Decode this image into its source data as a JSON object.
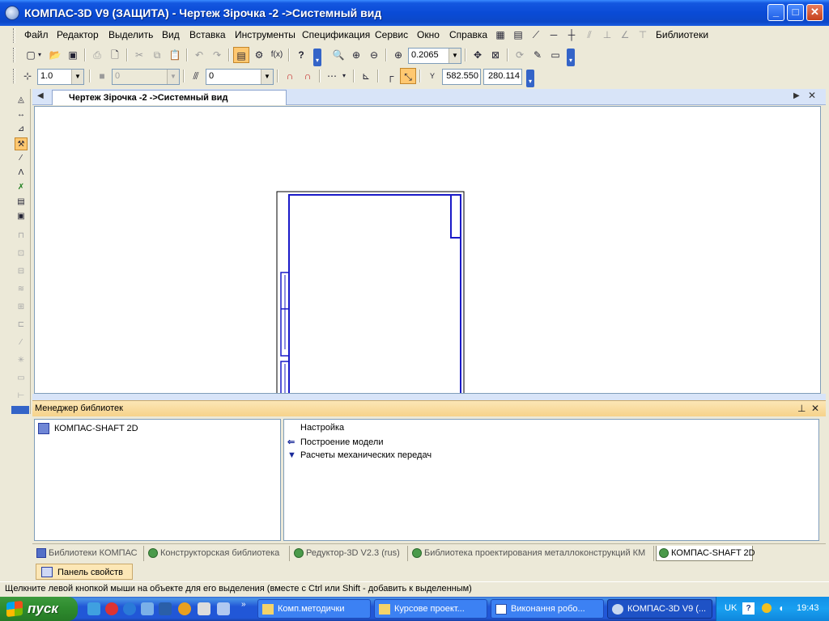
{
  "window": {
    "title": "КОМПАС-3D V9 (ЗАЩИТА) - Чертеж Зірочка -2 ->Системный вид",
    "minimize_glyph": "_",
    "maximize_glyph": "□",
    "close_glyph": "✕"
  },
  "menu": {
    "items": [
      "Файл",
      "Редактор",
      "Выделить",
      "Вид",
      "Вставка",
      "Инструменты",
      "Спецификация",
      "Сервис",
      "Окно",
      "Справка"
    ],
    "libraries": "Библиотеки"
  },
  "toolbar": {
    "zoom_value": "0.2065",
    "fx_label": "f(x)",
    "help_label": "?"
  },
  "toolbar2": {
    "step_value": "1.0",
    "layer_value": "0",
    "style_value": "0",
    "coord_x_label": "Y",
    "coord_x": "582.550",
    "coord_y": "280.114"
  },
  "document": {
    "tab_label": "Чертеж Зірочка -2 ->Системный вид"
  },
  "library_manager": {
    "title": "Менеджер библиотек",
    "tree_item": "КОМПАС-SHAFT 2D",
    "list_items": [
      "Настройка",
      "Построение модели",
      "Расчеты механических передач"
    ],
    "tabs": [
      "Библиотеки КОМПАС",
      "Конструкторская библиотека",
      "Редуктор-3D V2.3 (rus)",
      "Библиотека проектирования металлоконструкций КМ",
      "КОМПАС-SHAFT 2D"
    ]
  },
  "properties_tab": "Панель свойств",
  "status": "Щелкните левой кнопкой мыши на объекте для его выделения (вместе с Ctrl или Shift - добавить к выделенным)",
  "taskbar": {
    "start": "пуск",
    "tasks": [
      "Комп.методички",
      "Курсове проект...",
      "Виконання робо...",
      "КОМПАС-3D V9 (..."
    ],
    "language": "UK",
    "clock": "19:43"
  },
  "colors": {
    "drawing_line": "#1A1AC8",
    "selection": "#FFC870",
    "panel_header": "#F6D28A"
  }
}
